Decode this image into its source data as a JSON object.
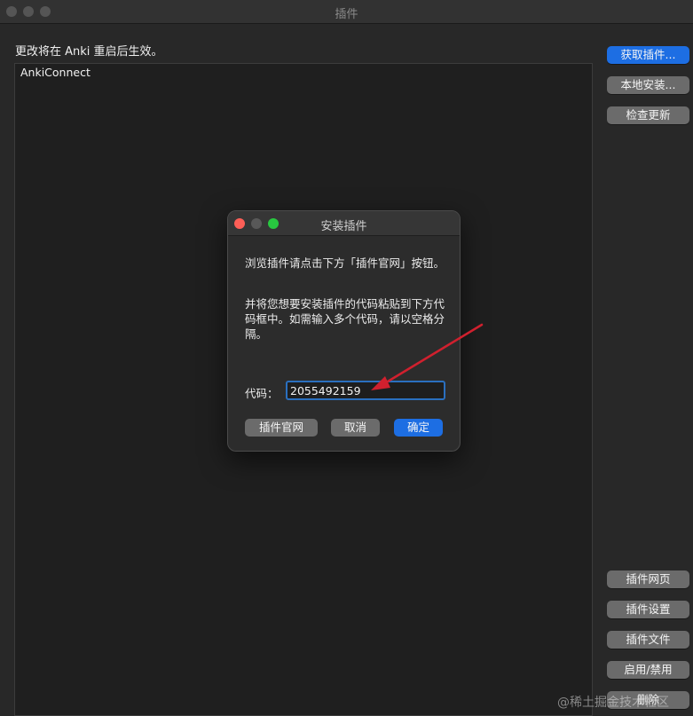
{
  "window": {
    "title": "插件",
    "notice": "更改将在 Anki 重启后生效。"
  },
  "addon_list": {
    "items": [
      "AnkiConnect"
    ]
  },
  "sidebar": {
    "top_buttons": [
      "获取插件...",
      "本地安装...",
      "检查更新"
    ],
    "bottom_buttons": [
      "插件网页",
      "插件设置",
      "插件文件",
      "启用/禁用",
      "删除"
    ]
  },
  "dialog": {
    "title": "安装插件",
    "paragraph1": "浏览插件请点击下方「插件官网」按钮。",
    "paragraph2": "并将您想要安装插件的代码粘贴到下方代码框中。如需输入多个代码，请以空格分隔。",
    "code_label": "代码：",
    "code_value": "2055492159",
    "buttons": {
      "website": "插件官网",
      "cancel": "取消",
      "ok": "确定"
    }
  },
  "watermark": "@稀土掘金技术社区",
  "colors": {
    "accent": "#1d6ee3",
    "arrow": "#d0202e",
    "close": "#fe5f57",
    "zoom": "#28c840"
  },
  "icons": [
    "annotation-arrow-icon"
  ]
}
